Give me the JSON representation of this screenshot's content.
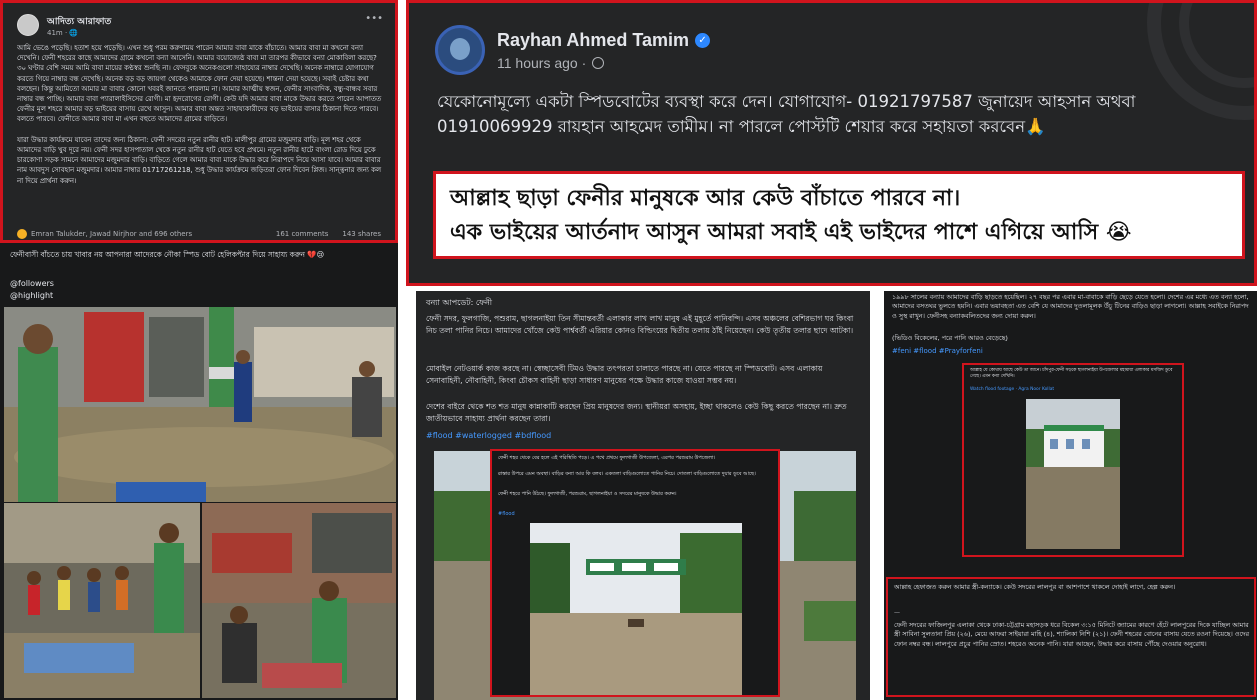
{
  "post1": {
    "author": "আদিত্য আরাফাত",
    "time": "41m · 🌐",
    "body": "আমি ভেঙে পড়েছি। হতাশ হয়ে পড়েছি। এখন শুধু পরম করুণাময় পারেন আমার বাবা মাকে বাঁচাতে। আমার বাবা মা কখনো বন্যা দেখেনি। ফেনী শহরের কাছে আমাদের গ্রামে কখনো বন্যা আসেনি। আমার বয়োজ্যেষ্ঠ বাবা মা তারপর কীভাবে বন্যা মোকাবিলা করছে? ৩০ ঘণ্টার বেশি সময় আমি বাবা মায়ের কণ্ঠস্বর শুনছি না। ফেসবুকে অনেকগুলো সাহায্যের নাম্বার দেখেছি। অনেক নাম্বারে যোগাযোগ করতে গিয়ে নাম্বার বন্ধ দেখেছি। অনেক বড় বড় জায়গা থেকেও আমাকে ফোন দেয়া হয়েছে। শান্তনা দেয়া হয়েছে। সবাই চেষ্টার কথা বলছেন। কিন্তু আমিতো আমার মা বাবার কোনো খবরই জানতে পারলাম না। আমার আত্মীয় স্বজন, ফেনীর সাংবাদিক, বন্ধু-বান্ধব সবার নাম্বার বন্ধ পাচ্ছি। আমার বাবা প্যারালাইসিসের রোগী। মা হৃদরোগের রোগী। কেউ যদি আমার বাবা মাকে উদ্ধার করতে পারেন আপাতত ফেনীর মূল শহরে আমার বড় ভাইয়ের বাসায় রেখে আসুন। আমার বাবা অন্তত সাহায্যকারীদের বড় ভাইয়ের বাসার ঠিকানা দিতে পারবে। বলতে পারবে। ফেনীতে আমার বাবা মা এখন বহুতে আমাদের গ্রামের বাড়িতে।\n\nযারা উদ্ধার কার্যক্রমে যাবেন তাদের জন্য ঠিকানা: ফেনী সদরের নতুন রানীর হাট। মালীপুর গ্রামের মজুমদার বাড়ি। মূল শহর থেকে আমাদের বাড়ি খুব দূরে নয়। ফেনী সদর হাসপাতাল থেকে নতুন রানীর হাট যেতে হবে প্রথমে। নতুন রানীর হাটে বাংলা রোড দিয়ে ঢুকে চারকোণা সড়ক সামনে আমাদের মজুমদার বাড়ি। বাড়িতে গেলে আমার বাবা মাকে উদ্ধার করে নিরাপদে নিয়ে আসা যাবে। আমার বাবার নাম আবদুস সোবহান মজুমদার। আমার নাম্বার 01717261218, শুধু উদ্ধার কার্যক্রমে জড়িতরা ফোন দিবেন প্লিজ। সান্ত্বনার জন্য কল না দিয়ে প্রার্থনা করুন।",
    "reactions": "Emran Talukder, Jawad Nirjhor and 696 others",
    "comments": "161 comments",
    "shares": "143 shares"
  },
  "post2": {
    "author": "Rayhan Ahmed Tamim",
    "time": "11 hours ago ·",
    "body": "যেকোনোমূল্যে একটা স্পিডবোটের ব্যবস্থা করে দেন। যোগাযোগ- 01921797587 জুনায়েদ আহসান অথবা\n01910069929 রায়হান আহমেদ তামীম। না পারলে পোস্টটি শেয়ার করে সহায়তা করবেন🙏",
    "highlight_line1": "আল্লাহ ছাড়া ফেনীর মানুষকে আর কেউ বাঁচাতে  পারবে না।",
    "highlight_line2": "এক ভাইয়ের আর্তনাদ আসুন আমরা সবাই এই ভাইদের পাশে এগিয়ে আসি 😭"
  },
  "post3": {
    "caption": "ফেনীবাসী বাঁচতে চায় খাবার নয় আপনারা আদেরকে নৌকা স্পিড বোট হেলিকপ্টার দিয়ে সাহায্য করুন 💔😢",
    "tag1": "@followers",
    "tag2": "@highlight"
  },
  "post4": {
    "title": "বন্যা আপডেট: ফেনী",
    "para1": "ফেনী সদর, ফুলগাজি, পশুরাম, ছাগলনাইয়া তিন সীমান্তবর্তী এলাকার লাখ লাখ মানুষ এই মুহূর্তে পানিবন্দি। এসব অঞ্চলের বেশিরভাগ ঘর কিংবা নিচ তলা পানির নিচে। আমাদের খোঁজে কেউ পার্শ্ববর্তী এরিয়ার কোনও বিল্ডিংয়ের দ্বিতীয় তলায় ঠাঁই নিয়েছেন। কেউ তৃতীয় তলার ছাদে আটকা।",
    "para2": "মোবাইল নেটওয়ার্ক কাজ করছে না। স্বেচ্ছাসেবী টিমও উদ্ধার তৎপরতা চালাতে পারছে না। যেতে পারছে না স্পিডবোট। এসব এলাকায় সেনাবাহিনী, নৌবাহিনী, কিংবা চৌকস বাহিনী ছাড়া সাধারণ মানুষের পক্ষে উদ্ধার কাজে যাওয়া সম্ভব নয়।",
    "para3": "দেশের বাইরে থেকে শত শত মানুষ কান্নাকাটি করছেন প্রিয় মানুষদের জন্য। স্থানীয়রা অসহায়, ইচ্ছা থাকলেও কেউ কিছু করতে পারছেন না। দ্রুত জাতীয়ভাবে সাহায্য প্রার্থনা করছেন তারা।",
    "hashtags": "#flood #waterlogged #bdflood",
    "inset_line1": "ফেনী শহর থেকে বের হলে এই পরিস্থিতি পড়ে। এ পথে প্রথমে ফুলগাজী উপজেলা, এরপর পরশুরাম উপজেলা।",
    "inset_line2": "রাস্তার উপরে এমন অবস্থা। বাড়ির বন্যা আর কি বলব। একতলা বাড়িগুলোতে পানির নিচে। দোতলা বাড়িগুলোতে দুয়ার ডুবে আছে।",
    "inset_line3": "ফেনী শহরে পানি উঠছে। ফুলগাজী, পরশুরাম, ছাগলনাইয়া ও সদরের মানুষকে উদ্ধার করুন।",
    "inset_tag": "#flood"
  },
  "post5": {
    "intro": "১৯৯৮ সালের বন্যায় আমাদের বাড়ি ছাড়তে হয়েছিল। ২৭ বছর পর এবার মা-বাবাকে বাড়ি ছেড়ে যেতে হলো। দেশের এর মধ্যে এত বন্যা হলো, আমাদের বসতঘর ভুলতে হয়নি। এবার ভয়াবহতা এত বেশি যে আমাদের দুতলামূলক উঁচু টিনের বাড়িও ছাড়া লাগলো। আল্লাহ সবাইকে নিরাপদ ও সুস্থ রাখুন। ফেনীসহ বন্যাকবলিতদের জন্য দোয়া করুন।",
    "video_note": "(ভিডিও বিকেলের, পরে পানি আরও বেড়েছে)",
    "hashtags": "#feni #flood #Prayforfeni",
    "inset_caption": "আল্লাহ যে কোথায় আছে কেউ তা জানে। চাঁদপুর-ফেনী সড়কে ছাগলনাইয়া উপজেলার মহামায়া এলাকার মসজিদ ডুবে গেছে। এমন বন্যা দেখিনি।",
    "inset_link": "Watch flood footage",
    "inset_link_post": "Agra Noor Kollat",
    "request_line": "আল্লাহ হেফাজত করুন আমার স্ত্রী-কন্যাকে। কেউ সদরের লালপুর বা আশপাশে থাকলে দোহাই লাগে, হেল্প করুন।",
    "request_body": "ফেনী সদরের ফাজিলপুর এলাকা থেকে ঢাকা-চট্টগ্রাম মহাসড়ক ধরে বিকেল ৩:১৫ মিনিটে জ্যামের কারণে হেঁটে লালপুরের দিকে যাচ্ছিল আমার স্ত্রী সাবিনা সুলতানা প্রিয় (২৬), মেয়ে আফরা সাইয়ারা মাহি (৪), শ্যালিকা নিশি (২১)। ফেনী শহরের বোনের বাসায় যেতে রওনা দিয়েছে। ওদের ফোন নম্বর বন্ধ। লালপুরে প্রচুর পানির স্রোত। শহরেও অনেক পানি। যারা আছেন, উদ্ধার করে বাসায় পৌঁছে দেওয়ার অনুরোধ।"
  }
}
